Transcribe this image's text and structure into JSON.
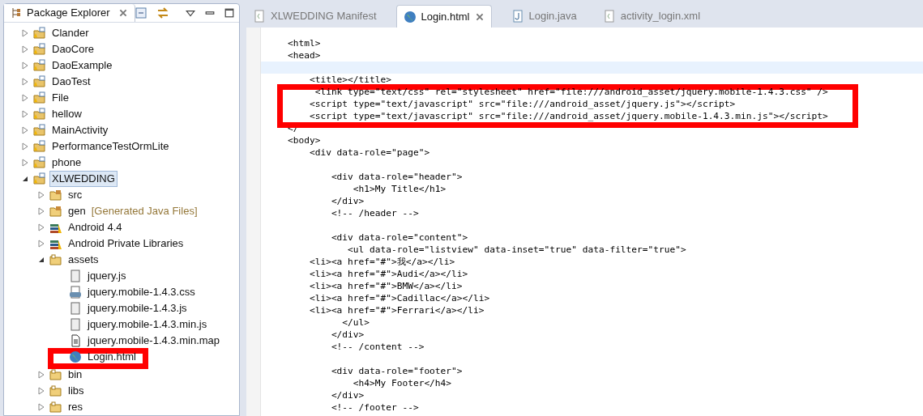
{
  "explorer": {
    "title": "Package Explorer",
    "items": [
      {
        "label": "Clander",
        "kind": "project",
        "expanded": false
      },
      {
        "label": "DaoCore",
        "kind": "project",
        "expanded": false
      },
      {
        "label": "DaoExample",
        "kind": "project",
        "expanded": false
      },
      {
        "label": "DaoTest",
        "kind": "project",
        "expanded": false
      },
      {
        "label": "File",
        "kind": "project",
        "expanded": false
      },
      {
        "label": "hellow",
        "kind": "project",
        "expanded": false
      },
      {
        "label": "MainActivity",
        "kind": "project",
        "expanded": false
      },
      {
        "label": "PerformanceTestOrmLite",
        "kind": "project",
        "expanded": false
      },
      {
        "label": "phone",
        "kind": "project",
        "expanded": false
      },
      {
        "label": "XLWEDDING",
        "kind": "project",
        "expanded": true,
        "selected": true,
        "children": [
          {
            "label": "src",
            "kind": "source",
            "expanded": false
          },
          {
            "label": "gen",
            "decoration": "[Generated Java Files]",
            "kind": "source",
            "expanded": false
          },
          {
            "label": "Android 4.4",
            "kind": "library",
            "expanded": false
          },
          {
            "label": "Android Private Libraries",
            "kind": "library",
            "expanded": false
          },
          {
            "label": "assets",
            "kind": "folder",
            "expanded": true,
            "children": [
              {
                "label": "jquery.js",
                "kind": "script"
              },
              {
                "label": "jquery.mobile-1.4.3.css",
                "kind": "css"
              },
              {
                "label": "jquery.mobile-1.4.3.js",
                "kind": "script"
              },
              {
                "label": "jquery.mobile-1.4.3.min.js",
                "kind": "script"
              },
              {
                "label": "jquery.mobile-1.4.3.min.map",
                "kind": "text"
              },
              {
                "label": "Login.html",
                "kind": "html",
                "boxed": true
              }
            ]
          },
          {
            "label": "bin",
            "kind": "folder",
            "expanded": false
          },
          {
            "label": "libs",
            "kind": "folder",
            "expanded": false
          },
          {
            "label": "res",
            "kind": "folder",
            "expanded": false
          }
        ]
      }
    ]
  },
  "editor": {
    "tabs": [
      {
        "label": "XLWEDDING Manifest",
        "kind": "xml",
        "selected": false
      },
      {
        "label": "Login.html",
        "kind": "html",
        "selected": true
      },
      {
        "label": "Login.java",
        "kind": "java",
        "selected": false
      },
      {
        "label": "activity_login.xml",
        "kind": "xml",
        "selected": false
      }
    ],
    "lines": [
      {
        "text": "<html>"
      },
      {
        "text": "<head>"
      },
      {
        "current": true
      },
      {
        "text": "    <title></title>"
      },
      {
        "text": "     <link type=\"text/css\" rel=\"stylesheet\" href=\"file:///android_asset/jquery.mobile-1.4.3.css\" />",
        "boxed": true
      },
      {
        "text": "    <script type=\"text/javascript\" src=\"file:///android_asset/jquery.js\"></script>",
        "boxed": true
      },
      {
        "text": "    <script type=\"text/javascript\" src=\"file:///android_asset/jquery.mobile-1.4.3.min.js\"></script>",
        "boxed": true
      },
      {
        "text": "</"
      },
      {
        "text": "<body>"
      },
      {
        "text": "    <div data-role=\"page\">"
      },
      {
        "text": "        <div data-role=\"header\">",
        "space_above": true
      },
      {
        "text": "            <h1>My Title</h1>"
      },
      {
        "text": "        </div>"
      },
      {
        "text": "        <!-- /header -->"
      },
      {
        "text": "        <div data-role=\"content\">",
        "space_above": true
      },
      {
        "text": "           <ul data-role=\"listview\" data-inset=\"true\" data-filter=\"true\">"
      },
      {
        "text": "    <li><a href=\"#\">我</a></li>"
      },
      {
        "text": "    <li><a href=\"#\">Audi</a></li>"
      },
      {
        "text": "    <li><a href=\"#\">BMW</a></li>"
      },
      {
        "text": "    <li><a href=\"#\">Cadillac</a></li>"
      },
      {
        "text": "    <li><a href=\"#\">Ferrari</a></li>"
      },
      {
        "text": "          </ul>"
      },
      {
        "text": "        </div>"
      },
      {
        "text": "        <!-- /content -->"
      },
      {
        "text": "        <div data-role=\"footer\">",
        "space_above": true
      },
      {
        "text": "            <h4>My Footer</h4>"
      },
      {
        "text": "        </div>"
      },
      {
        "text": "        <!-- /footer -->"
      }
    ]
  }
}
